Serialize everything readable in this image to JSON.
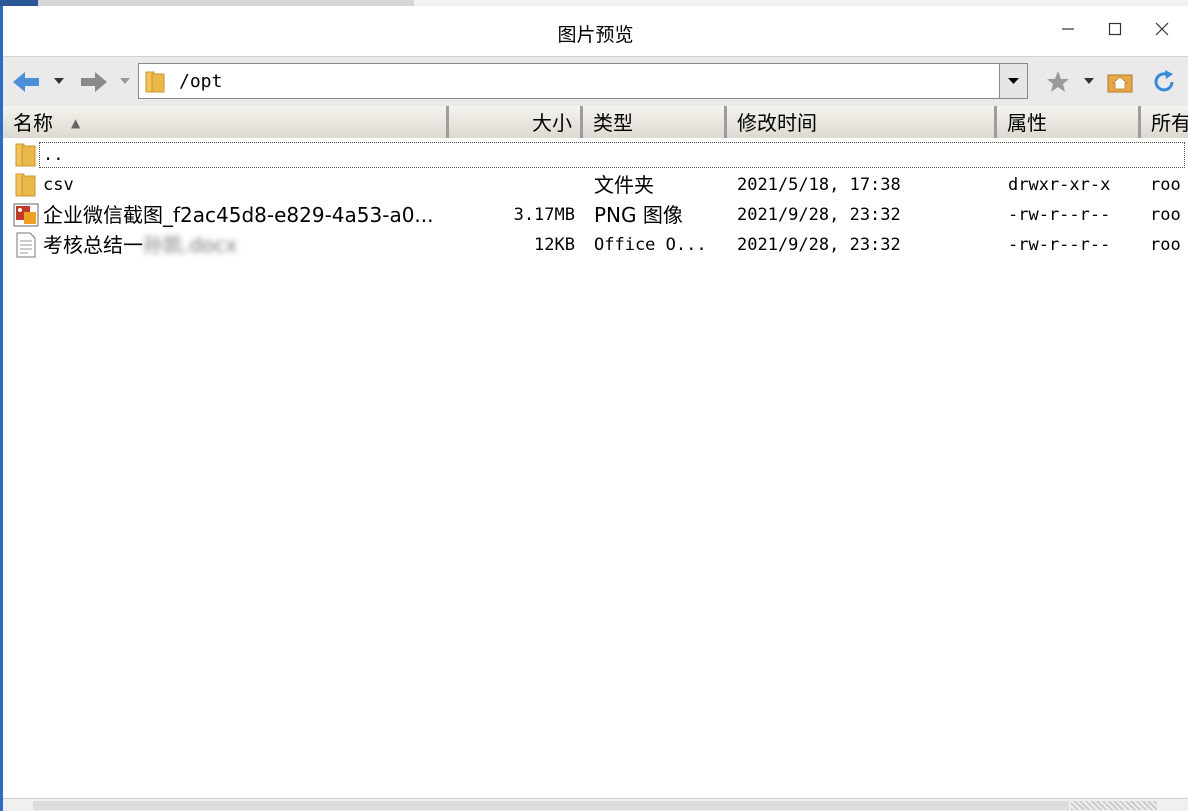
{
  "window": {
    "title": "图片预览"
  },
  "toolbar": {
    "back_icon": "arrow-left-icon",
    "forward_icon": "arrow-right-icon",
    "address_path": "/opt",
    "favorites_icon": "star-icon",
    "home_icon": "home-folder-icon",
    "refresh_icon": "refresh-icon"
  },
  "columns": [
    {
      "key": "name",
      "label": "名称"
    },
    {
      "key": "size",
      "label": "大小"
    },
    {
      "key": "type",
      "label": "类型"
    },
    {
      "key": "modified",
      "label": "修改时间"
    },
    {
      "key": "attributes",
      "label": "属性"
    },
    {
      "key": "owner",
      "label": "所有"
    }
  ],
  "rows": [
    {
      "name": "..",
      "size": "",
      "type": "",
      "modified": "",
      "attributes": "",
      "owner": "",
      "icon": "folder-icon"
    },
    {
      "name": "csv",
      "size": "",
      "type": "文件夹",
      "modified": "2021/5/18, 17:38",
      "attributes": "drwxr-xr-x",
      "owner": "roo",
      "icon": "folder-icon"
    },
    {
      "name": "企业微信截图_f2ac45d8-e829-4a53-a0...",
      "size": "3.17MB",
      "type": "PNG 图像",
      "modified": "2021/9/28, 23:32",
      "attributes": "-rw-r--r--",
      "owner": "roo",
      "icon": "image-file-icon"
    },
    {
      "name": "考核总结一",
      "name_blurred": "孙凯.docx",
      "size": "12KB",
      "type": "Office O...",
      "modified": "2021/9/28, 23:32",
      "attributes": "-rw-r--r--",
      "owner": "roo",
      "icon": "document-file-icon"
    }
  ],
  "colors": {
    "window_border": "#2b6cc4",
    "folder": "#e8b84a",
    "arrow_blue": "#4a90d9"
  }
}
